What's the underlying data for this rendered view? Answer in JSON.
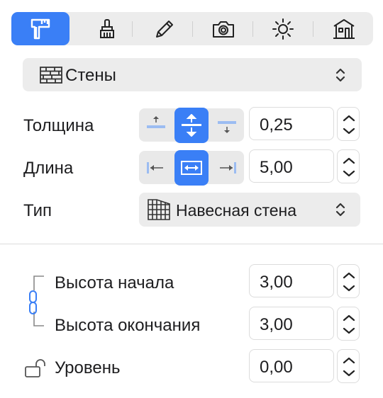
{
  "toolbar": {
    "tabs": [
      {
        "icon": "calipers-icon",
        "active": true
      },
      {
        "icon": "brush-icon",
        "active": false
      },
      {
        "icon": "pencil-icon",
        "active": false
      },
      {
        "icon": "camera-icon",
        "active": false
      },
      {
        "icon": "sun-icon",
        "active": false
      },
      {
        "icon": "house-icon",
        "active": false
      }
    ]
  },
  "category": {
    "label": "Стены",
    "icon": "wall-icon"
  },
  "thickness": {
    "label": "Толщина",
    "value": "0,25"
  },
  "length": {
    "label": "Длина",
    "value": "5,00"
  },
  "type": {
    "label": "Тип",
    "value": "Навесная стена",
    "icon": "curtain-wall-icon"
  },
  "start_height": {
    "label": "Высота начала",
    "value": "3,00"
  },
  "end_height": {
    "label": "Высота окончания",
    "value": "3,00"
  },
  "level": {
    "label": "Уровень",
    "value": "0,00"
  },
  "colors": {
    "accent": "#3a7ff6",
    "panel": "#ececec"
  }
}
